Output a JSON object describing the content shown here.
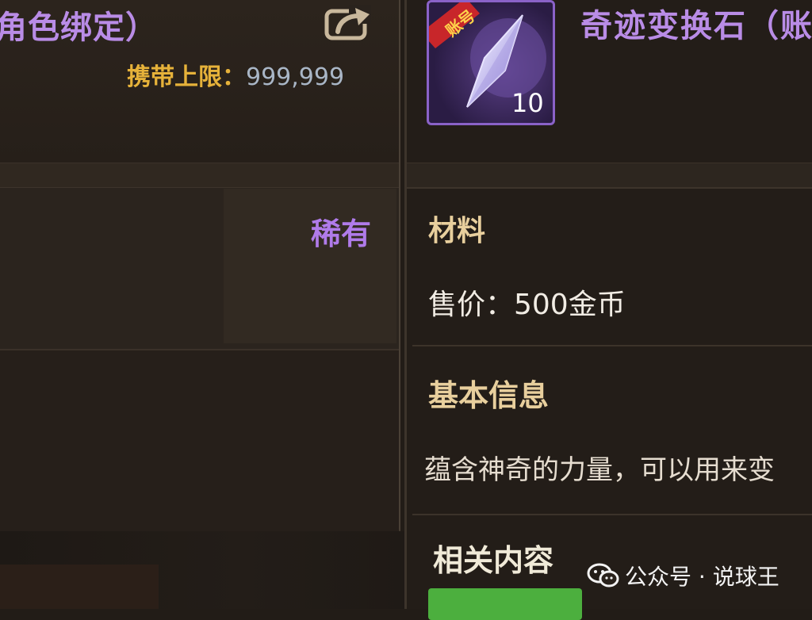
{
  "left_panel": {
    "title": "角色绑定）",
    "carry_limit_label": "携带上限：",
    "carry_limit_value": "999,999",
    "rarity": "稀有"
  },
  "item": {
    "title": "奇迹变换石（账",
    "badge": "账号",
    "stack_count": "10",
    "category": "材料",
    "price": "售价：500金币",
    "basic_info_heading": "基本信息",
    "description": "蕴含神奇的力量，可以用来变",
    "related_heading": "相关内容"
  },
  "watermark": {
    "text": "公众号 · 说球王"
  },
  "colors": {
    "rarity_purple": "#b07bea",
    "title_purple": "#b98ce6",
    "gold_label": "#e6b23a",
    "section_heading": "#e8cf9d",
    "green_button": "#4caf3e",
    "badge_red": "#c8262a"
  },
  "icons": [
    "share-icon",
    "crystal-icon",
    "wechat-icon"
  ]
}
